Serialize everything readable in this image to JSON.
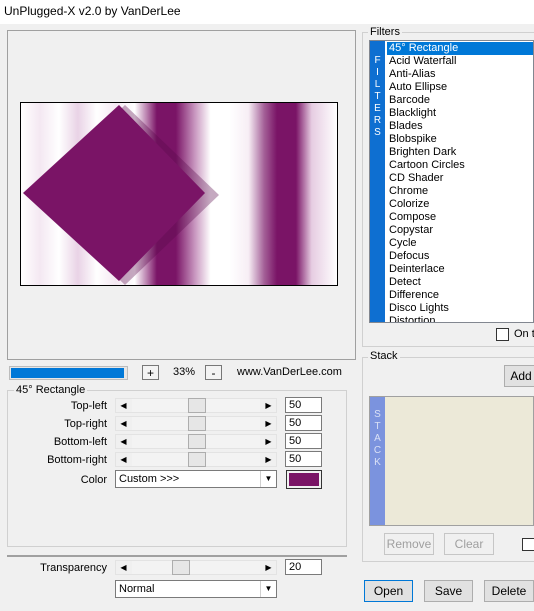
{
  "window": {
    "title": "UnPlugged-X v2.0 by VanDerLee"
  },
  "preview": {
    "progress_fraction": 0.98
  },
  "zoom": {
    "value": "33%",
    "plus_label": "+",
    "minus_label": "-"
  },
  "website": "www.VanDerLee.com",
  "params": {
    "group_label": "45° Rectangle",
    "sliders": [
      {
        "label": "Top-left",
        "value": "50",
        "fraction": 0.5
      },
      {
        "label": "Top-right",
        "value": "50",
        "fraction": 0.5
      },
      {
        "label": "Bottom-left",
        "value": "50",
        "fraction": 0.5
      },
      {
        "label": "Bottom-right",
        "value": "50",
        "fraction": 0.5
      }
    ],
    "color_label": "Color",
    "color_mode": "Custom >>>",
    "color_value": "#7a1466",
    "transparency_label": "Transparency",
    "transparency_value": "20",
    "transparency_fraction": 0.2,
    "blend_mode": "Normal"
  },
  "filters": {
    "group_label": "Filters",
    "side_letters": [
      "F",
      "I",
      "L",
      "T",
      "E",
      "R",
      "S"
    ],
    "items": [
      "45° Rectangle",
      "Acid Waterfall",
      "Anti-Alias",
      "Auto Ellipse",
      "Barcode",
      "Blacklight",
      "Blades",
      "Blobspike",
      "Brighten Dark",
      "Cartoon Circles",
      "CD Shader",
      "Chrome",
      "Colorize",
      "Compose",
      "Copystar",
      "Cycle",
      "Defocus",
      "Deinterlace",
      "Detect",
      "Difference",
      "Disco Lights",
      "Distortion"
    ],
    "selected_index": 0,
    "ontop_label": "On t"
  },
  "stack": {
    "group_label": "Stack",
    "side_letters": [
      "S",
      "T",
      "A",
      "C",
      "K"
    ],
    "add_label": "Add",
    "remove_label": "Remove",
    "clear_label": "Clear"
  },
  "buttons": {
    "open": "Open",
    "save": "Save",
    "delete": "Delete"
  },
  "colors": {
    "accent": "#0078d7",
    "stack_bar": "#7b93de",
    "filter_bar": "#0e6fd1",
    "effect": "#7a1466"
  }
}
